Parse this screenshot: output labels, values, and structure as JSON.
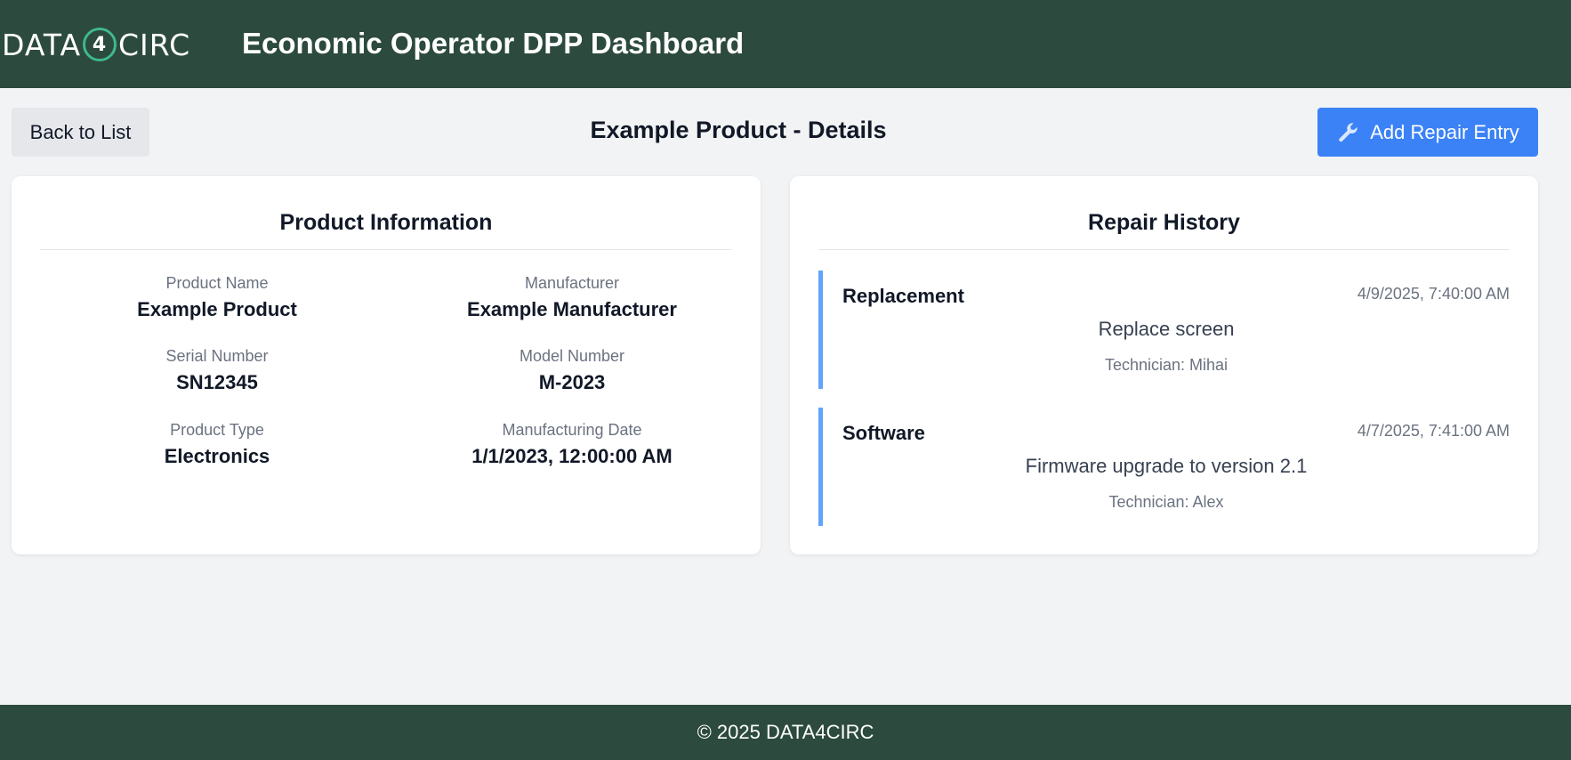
{
  "header": {
    "logo": {
      "prefix": "DATA",
      "digit": "4",
      "suffix": "CIRC",
      "ring_color": "#3fb98c"
    },
    "title": "Economic Operator DPP Dashboard",
    "background": "#2c4a3e"
  },
  "toolbar": {
    "back_label": "Back to List",
    "page_title": "Example Product - Details",
    "add_repair_label": "Add Repair Entry",
    "add_repair_icon": "wrench-icon",
    "accent": "#3b82f6"
  },
  "product_info": {
    "title": "Product Information",
    "fields": [
      {
        "label": "Product Name",
        "value": "Example Product"
      },
      {
        "label": "Manufacturer",
        "value": "Example Manufacturer"
      },
      {
        "label": "Serial Number",
        "value": "SN12345"
      },
      {
        "label": "Model Number",
        "value": "M-2023"
      },
      {
        "label": "Product Type",
        "value": "Electronics"
      },
      {
        "label": "Manufacturing Date",
        "value": "1/1/2023, 12:00:00 AM"
      }
    ]
  },
  "repair_history": {
    "title": "Repair History",
    "entries": [
      {
        "type": "Replacement",
        "date": "4/9/2025, 7:40:00 AM",
        "description": "Replace screen",
        "technician": "Technician: Mihai"
      },
      {
        "type": "Software",
        "date": "4/7/2025, 7:41:00 AM",
        "description": "Firmware upgrade to version 2.1",
        "technician": "Technician: Alex"
      }
    ],
    "accent": "#60a5fa"
  },
  "footer": {
    "text": "© 2025 DATA4CIRC"
  }
}
